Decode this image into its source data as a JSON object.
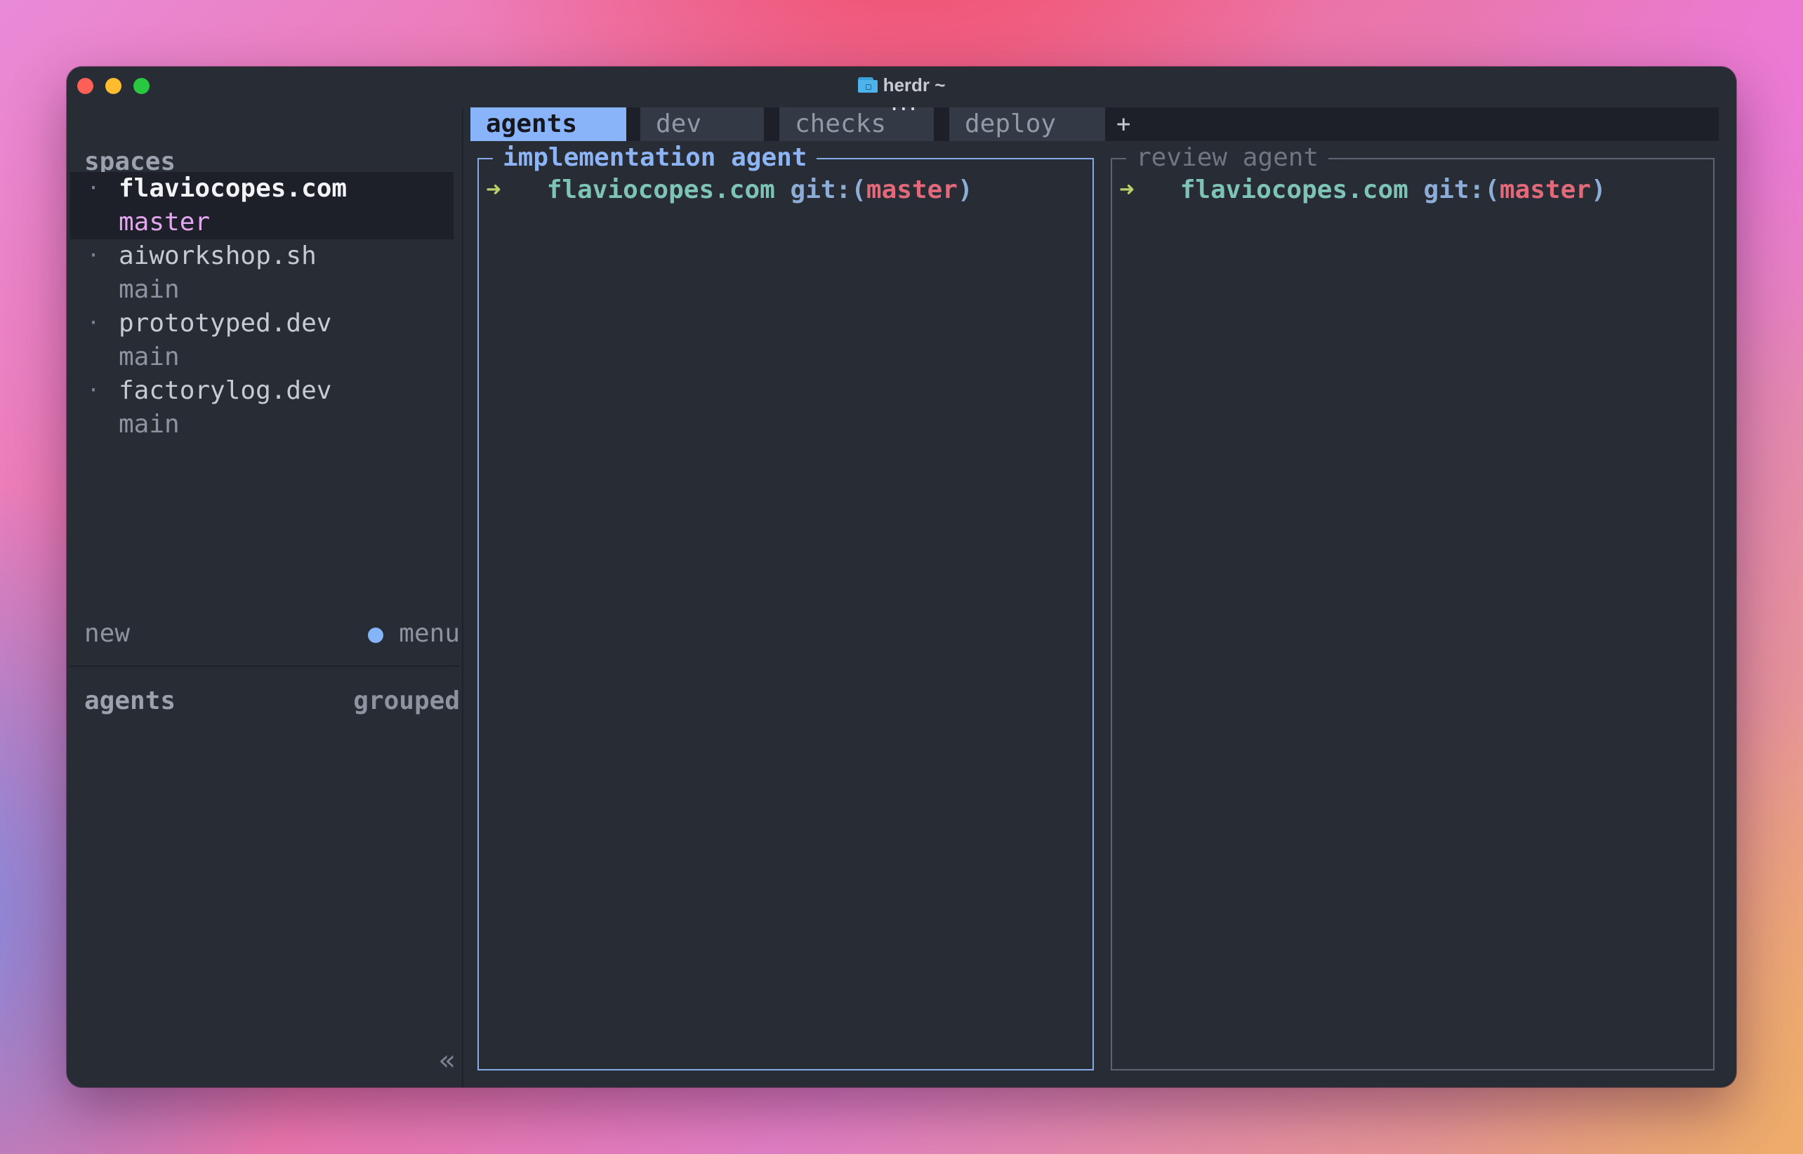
{
  "window": {
    "title": "herdr ~",
    "title_icon": "folder-icon",
    "traffic_lights": [
      "close",
      "minimize",
      "maximize"
    ]
  },
  "sidebar": {
    "spaces_heading": "spaces",
    "spaces": [
      {
        "name": "flaviocopes.com",
        "branch": "master",
        "active": true
      },
      {
        "name": "aiworkshop.sh",
        "branch": "main",
        "active": false
      },
      {
        "name": "prototyped.dev",
        "branch": "main",
        "active": false
      },
      {
        "name": "factorylog.dev",
        "branch": "main",
        "active": false
      }
    ],
    "bullet": "·",
    "new_label": "new",
    "menu_label": "menu",
    "agents_heading": "agents",
    "grouped_label": "grouped",
    "collapse_glyph": "«"
  },
  "tabs": {
    "items": [
      {
        "label": "agents",
        "active": true
      },
      {
        "label": "dev",
        "active": false
      },
      {
        "label": "checks",
        "active": false
      },
      {
        "label": "deploy",
        "active": false
      }
    ],
    "add_label": "+",
    "overflow_glyph": "..."
  },
  "panes": [
    {
      "title": "implementation agent",
      "focused": true,
      "prompt": {
        "arrow": "➜",
        "dir": "flaviocopes.com",
        "git_open": "git:(",
        "branch": "master",
        "git_close": ")"
      }
    },
    {
      "title": "review agent",
      "focused": false,
      "prompt": {
        "arrow": "➜",
        "dir": "flaviocopes.com",
        "git_open": "git:(",
        "branch": "master",
        "git_close": ")"
      }
    }
  ],
  "colors": {
    "window_bg": "#282c35",
    "accent": "#89b4fa",
    "branch_active": "#e3a7f0",
    "prompt_arrow": "#b8d26b",
    "prompt_dir": "#7ec4b6",
    "prompt_branch": "#e2697a"
  }
}
